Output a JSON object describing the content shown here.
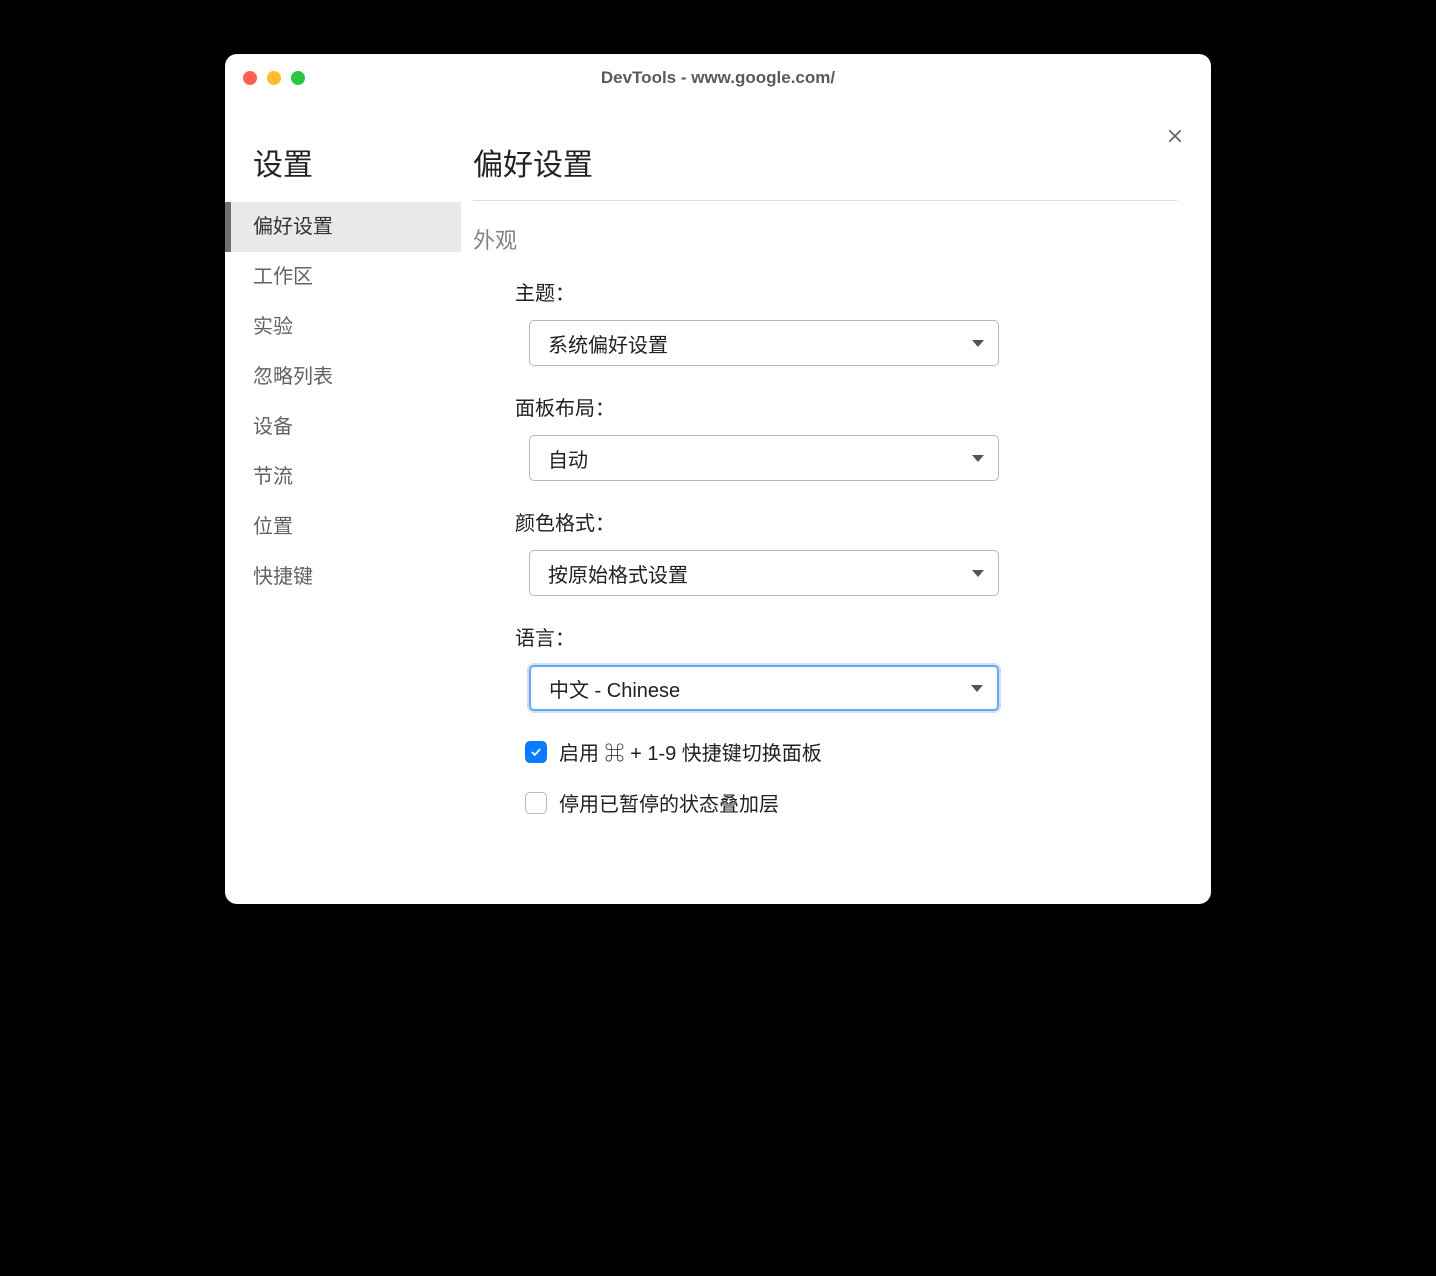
{
  "window": {
    "title": "DevTools - www.google.com/"
  },
  "sidebar": {
    "heading": "设置",
    "items": [
      {
        "label": "偏好设置",
        "active": true
      },
      {
        "label": "工作区",
        "active": false
      },
      {
        "label": "实验",
        "active": false
      },
      {
        "label": "忽略列表",
        "active": false
      },
      {
        "label": "设备",
        "active": false
      },
      {
        "label": "节流",
        "active": false
      },
      {
        "label": "位置",
        "active": false
      },
      {
        "label": "快捷键",
        "active": false
      }
    ]
  },
  "main": {
    "heading": "偏好设置",
    "section": "外观",
    "fields": {
      "theme": {
        "label": "主题：",
        "value": "系统偏好设置"
      },
      "panelLayout": {
        "label": "面板布局：",
        "value": "自动"
      },
      "colorFormat": {
        "label": "颜色格式：",
        "value": "按原始格式设置"
      },
      "language": {
        "label": "语言：",
        "value": "中文 - Chinese",
        "focused": true
      }
    },
    "checkboxes": {
      "enableShortcut": {
        "label": "启用 ⌘ + 1-9 快捷键切换面板",
        "checked": true
      },
      "disableOverlay": {
        "label": "停用已暂停的状态叠加层",
        "checked": false
      }
    }
  }
}
